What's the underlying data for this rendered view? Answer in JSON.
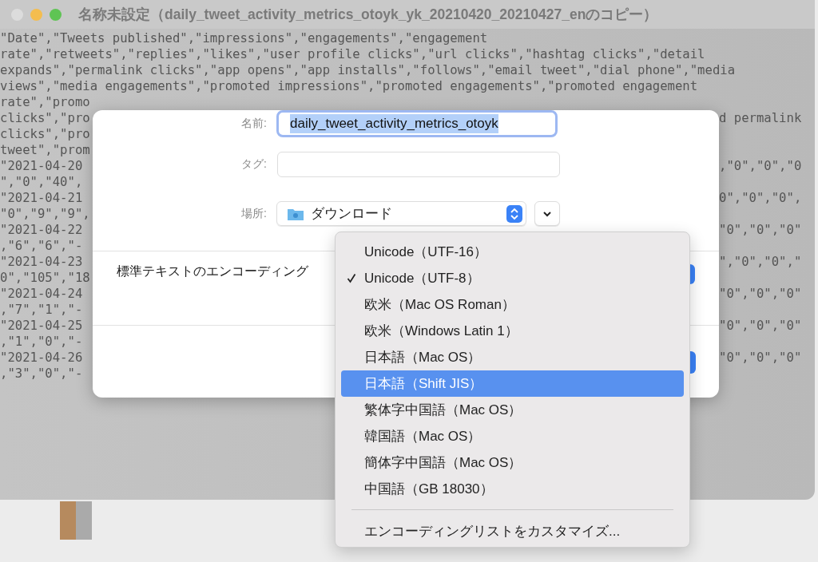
{
  "window": {
    "title": "名称未設定（daily_tweet_activity_metrics_otoyk_yk_20210420_20210427_enのコピー）"
  },
  "editor": {
    "lines": [
      {
        "left": "\"Date\",\"Tweets published\",\"impressions\",\"engagements\",\"engagement"
      },
      {
        "left": "rate\",\"retweets\",\"replies\",\"likes\",\"user profile clicks\",\"url clicks\",\"hashtag clicks\",\"detail"
      },
      {
        "left": "expands\",\"permalink clicks\",\"app opens\",\"app installs\",\"follows\",\"email tweet\",\"dial phone\",\"media"
      },
      {
        "left": "views\",\"media engagements\",\"promoted impressions\",\"promoted engagements\",\"promoted engagement"
      },
      {
        "left": "rate\",\"promo"
      },
      {
        "left": "clicks\",\"pro",
        "right": "d permalink"
      },
      {
        "left": "clicks\",\"pro"
      },
      {
        "left": "tweet\",\"prom"
      },
      {
        "left": "\"2021-04-20",
        "right": ",\"0\",\"0\",\"0"
      },
      {
        "left": "\",\"0\",\"40\","
      },
      {
        "left": "\"2021-04-21",
        "right": "0\",\"0\",\"0\","
      },
      {
        "left": "\"0\",\"9\",\"9\","
      },
      {
        "left": "\"2021-04-22",
        "right": "\"0\",\"0\",\"0\""
      },
      {
        "left": ",\"6\",\"6\",\"-"
      },
      {
        "left": "\"2021-04-23",
        "right": "\",\"0\",\"0\",\""
      },
      {
        "left": "0\",\"105\",\"18"
      },
      {
        "left": "\"2021-04-24",
        "right": "\"0\",\"0\",\"0\""
      },
      {
        "left": ",\"7\",\"1\",\"-"
      },
      {
        "left": "\"2021-04-25",
        "right": "\"0\",\"0\",\"0\""
      },
      {
        "left": ",\"1\",\"0\",\"-"
      },
      {
        "left": "\"2021-04-26",
        "right": "\"0\",\"0\",\"0\""
      },
      {
        "left": ",\"3\",\"0\",\"-"
      }
    ]
  },
  "save_sheet": {
    "name_label": "名前:",
    "name_value": "daily_tweet_activity_metrics_otoyk",
    "tags_label": "タグ:",
    "location_label": "場所:",
    "location_value": "ダウンロード",
    "encoding_label": "標準テキストのエンコーディング"
  },
  "encoding_menu": {
    "items": [
      {
        "label": "Unicode（UTF-16）",
        "selected": false,
        "highlighted": false
      },
      {
        "label": "Unicode（UTF-8）",
        "selected": true,
        "highlighted": false
      },
      {
        "label": "欧米（Mac OS Roman）",
        "selected": false,
        "highlighted": false
      },
      {
        "label": "欧米（Windows Latin 1）",
        "selected": false,
        "highlighted": false
      },
      {
        "label": "日本語（Mac OS）",
        "selected": false,
        "highlighted": false
      },
      {
        "label": "日本語（Shift JIS）",
        "selected": false,
        "highlighted": true
      },
      {
        "label": "繁体字中国語（Mac OS）",
        "selected": false,
        "highlighted": false
      },
      {
        "label": "韓国語（Mac OS）",
        "selected": false,
        "highlighted": false
      },
      {
        "label": "簡体字中国語（Mac OS）",
        "selected": false,
        "highlighted": false
      },
      {
        "label": "中国語（GB 18030）",
        "selected": false,
        "highlighted": false
      }
    ],
    "customize_item": "エンコーディングリストをカスタマイズ..."
  }
}
